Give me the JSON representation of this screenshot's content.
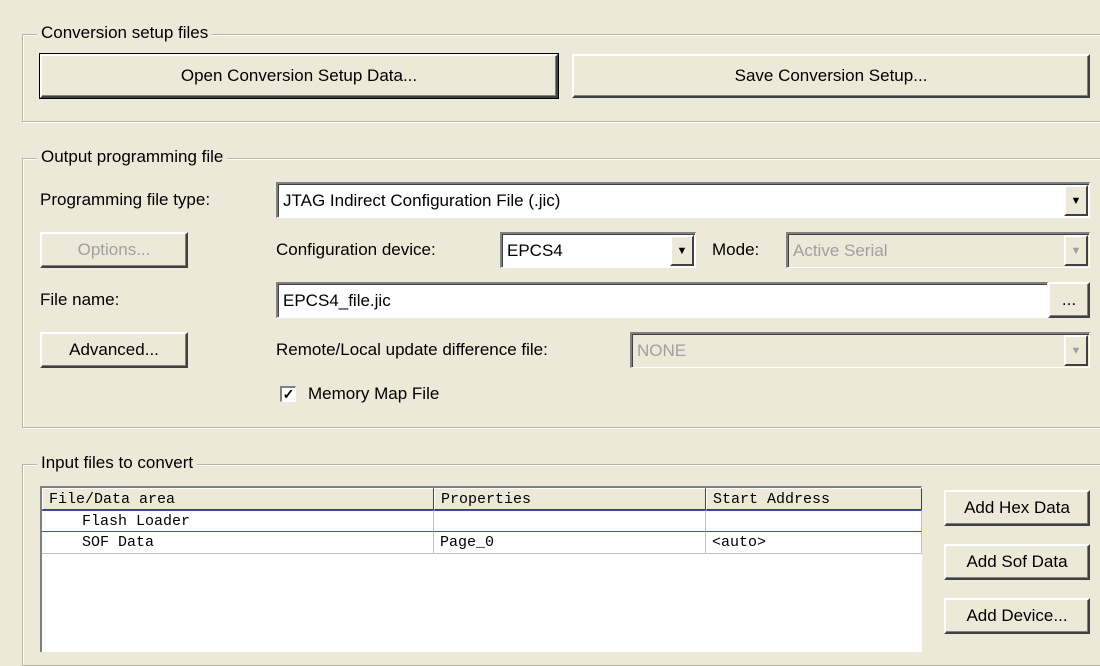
{
  "conversion_setup": {
    "legend": "Conversion setup files",
    "open_label": "Open Conversion Setup Data...",
    "save_label": "Save Conversion Setup..."
  },
  "output": {
    "legend": "Output programming file",
    "file_type_label": "Programming file type:",
    "file_type_value": "JTAG Indirect Configuration File (.jic)",
    "options_label": "Options...",
    "config_device_label": "Configuration device:",
    "config_device_value": "EPCS4",
    "mode_label": "Mode:",
    "mode_value": "Active Serial",
    "file_name_label": "File name:",
    "file_name_value": "EPCS4_file.jic",
    "browse_label": "...",
    "advanced_label": "Advanced...",
    "remote_label": "Remote/Local update difference file:",
    "remote_value": "NONE",
    "memory_map_label": "Memory Map File",
    "memory_map_checked": true
  },
  "input": {
    "legend": "Input files to convert",
    "columns": [
      "File/Data area",
      "Properties",
      "Start Address"
    ],
    "rows": [
      {
        "file": "Flash Loader",
        "properties": "",
        "start": ""
      },
      {
        "file": "SOF Data",
        "properties": "Page_0",
        "start": "<auto>"
      }
    ],
    "add_hex_label": "Add Hex Data",
    "add_sof_label": "Add Sof Data",
    "add_device_label": "Add Device..."
  }
}
